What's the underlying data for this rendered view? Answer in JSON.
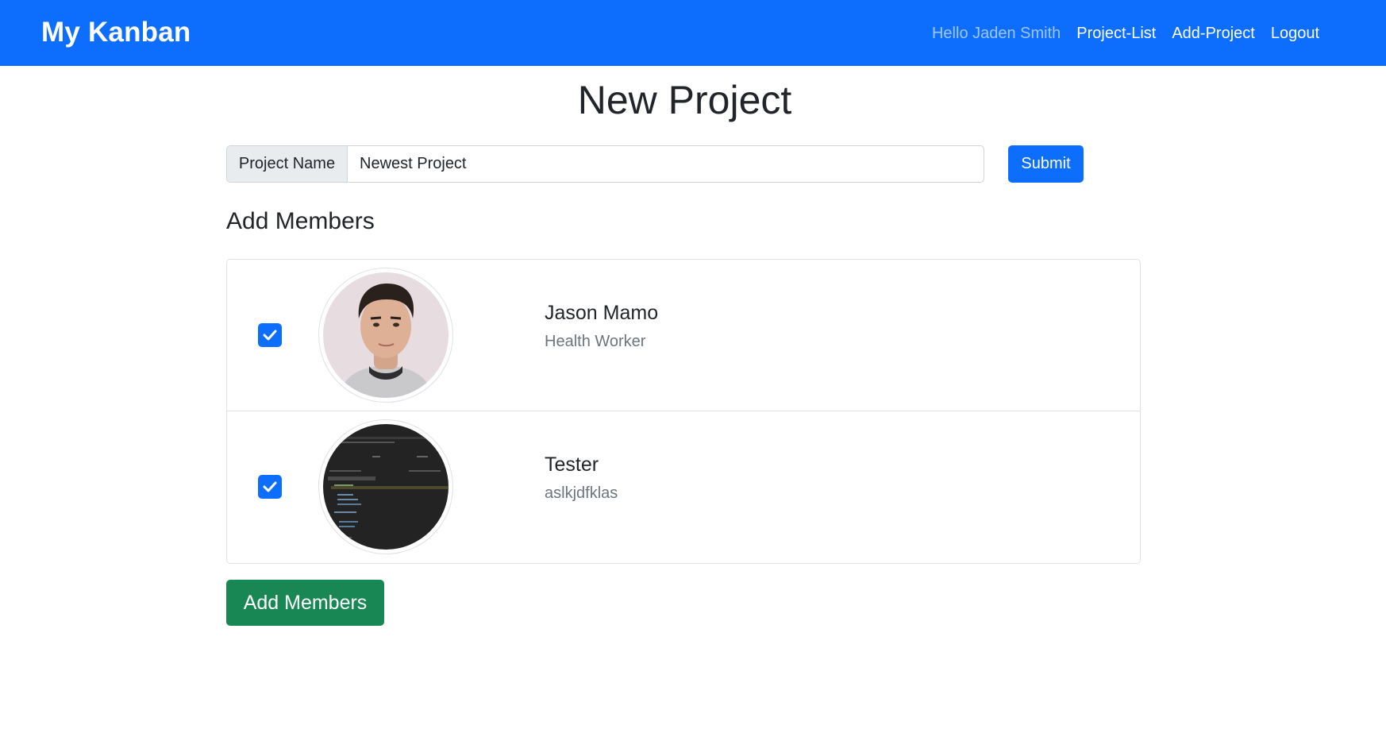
{
  "navbar": {
    "brand": "My Kanban",
    "greeting": "Hello Jaden Smith",
    "links": [
      "Project-List",
      "Add-Project",
      "Logout"
    ]
  },
  "page": {
    "title": "New Project"
  },
  "form": {
    "label": "Project Name",
    "value": "Newest Project",
    "submit_label": "Submit"
  },
  "members_section": {
    "title": "Add Members",
    "members": [
      {
        "name": "Jason Mamo",
        "role": "Health Worker",
        "checked": true,
        "avatar_icon": "person-photo-icon"
      },
      {
        "name": "Tester",
        "role": "aslkjdfklas",
        "checked": true,
        "avatar_icon": "code-screenshot-icon"
      }
    ],
    "add_button_label": "Add Members"
  },
  "colors": {
    "primary": "#0d6efd",
    "success": "#198754",
    "muted": "#6c757d"
  }
}
